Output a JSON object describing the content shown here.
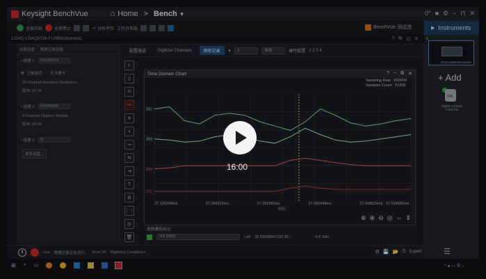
{
  "app": {
    "title": "Keysight BenchVue",
    "nav_home": "Home",
    "nav_sep": ">",
    "nav_bench": "Bench",
    "bv_label": "BenchVue 测试流"
  },
  "window_controls": [
    "0°",
    "■",
    "⚙",
    "−",
    "⊓",
    "✕"
  ],
  "toolbar": {
    "run_all": "全部开始",
    "stop_all": "全部停止",
    "save": "",
    "open": "",
    "export": "分析平台",
    "workspace": "工作台布局"
  },
  "instruments_tab": "Instruments",
  "path": "1:DAQ // DAQ973A // USBInstrument2",
  "path_icons": [
    "?",
    "⧉",
    "⊡",
    "✕"
  ],
  "left_panel": {
    "tabs": [
      "仪器设置",
      "数据记录设置"
    ],
    "slot1_label": "• 插槽 1:",
    "slot1_value": "DAQM901A",
    "slot1_radio_a": "已被激活",
    "slot1_radio_b": "无卡槽卡",
    "slot1_desc": "20-Channel Armature Multiplexe...",
    "slot1_ver": "版本: 01.02",
    "slot2_label": "• 插槽 2:",
    "slot2_value": "DAQM909A",
    "slot2_desc": "4-Channel Digitizer Module",
    "slot2_ver": "版本: 00.46",
    "slot3_label": "• 插槽 3:",
    "slot3_value": "无",
    "more_btn": "更多设置..."
  },
  "main_tabs": [
    "配置通道",
    "Digitizer Channels",
    "图形记录"
  ],
  "main_field_a": "1",
  "main_field_b": "未命",
  "main_tool_label": "硬件配置",
  "main_dots": "1 2 3 4",
  "tools": [
    "⊦",
    "▯",
    "⎌",
    "〰",
    "✕",
    "▪",
    "⊸",
    "⇆",
    "⇥",
    "T",
    "ılı",
    "⋮⋮",
    "◎",
    "🗑"
  ],
  "chart": {
    "title": "Time Domain Chart",
    "title_icons": [
      "?",
      "−",
      "⧉",
      "✕"
    ],
    "sampling_rate": "Sampling Rate : 800000",
    "samples_count": "Samples Count : 51200",
    "xlabel": "时间",
    "ch_labels": [
      "202",
      "203",
      "204",
      "201"
    ],
    "bottom_icons": [
      "⊕",
      "⊕",
      "⊖",
      "◎",
      "⇔",
      "⇕"
    ]
  },
  "chart_data": {
    "type": "line",
    "title": "Time Domain Chart",
    "xlabel": "时间",
    "ylabel": "",
    "x_ticks": [
      "27.126249ms",
      "27.204316ms",
      "27.282382ms",
      "27.360448ms",
      "27.438515ms",
      "27.516581ms"
    ],
    "grid": true,
    "series": [
      {
        "name": "202",
        "color": "#8fd6a0",
        "values": [
          0.86,
          0.88,
          0.75,
          0.72,
          0.8,
          0.82,
          0.8,
          0.74,
          0.7,
          0.66,
          0.74,
          0.86,
          0.8,
          0.73,
          0.7,
          0.72,
          0.75,
          0.77
        ]
      },
      {
        "name": "203",
        "color": "#a4e6b4",
        "values": [
          0.58,
          0.57,
          0.55,
          0.56,
          0.6,
          0.62,
          0.6,
          0.56,
          0.54,
          0.6,
          0.68,
          0.62,
          0.57,
          0.55,
          0.56,
          0.58,
          0.6,
          0.62
        ]
      },
      {
        "name": "204",
        "color": "#e85a5a",
        "values": [
          0.3,
          0.31,
          0.33,
          0.33,
          0.33,
          0.33,
          0.33,
          0.33,
          0.33,
          0.38,
          0.4,
          0.38,
          0.36,
          0.34,
          0.33,
          0.33,
          0.33,
          0.33
        ]
      },
      {
        "name": "201",
        "color": "#c43a3a",
        "values": [
          0.09,
          0.09,
          0.09,
          0.09,
          0.09,
          0.09,
          0.09,
          0.09,
          0.09,
          0.12,
          0.14,
          0.12,
          0.11,
          0.11,
          0.11,
          0.11,
          0.11,
          0.11
        ]
      }
    ]
  },
  "legend": {
    "header": "选择通道/标记",
    "channel": "201 (DAQ)",
    "left": "Left",
    "value": "36.63008847282 W /",
    "vdiv": "4.8 Vdiv"
  },
  "status": {
    "pause": "Ⅱ",
    "text1": "Uso",
    "text2": "数据记录正在运行...",
    "scan": "Scan 92",
    "completed": "Digitizing Completed",
    "export": "Export"
  },
  "status_icons": [
    "⚙",
    "💾",
    "📂",
    "⏱"
  ],
  "instr_panel": {
    "slot": "1",
    "thumb_label": "DAQ USBInstrument2",
    "add_label": "+ Add",
    "sr_label": "Digital Controls",
    "sr_sub": "COM Out"
  },
  "hamburger": "☰",
  "overlay": {
    "timecode": "16:00"
  },
  "taskbar": {
    "tray": "^ ● ▭ 中 ♪"
  }
}
